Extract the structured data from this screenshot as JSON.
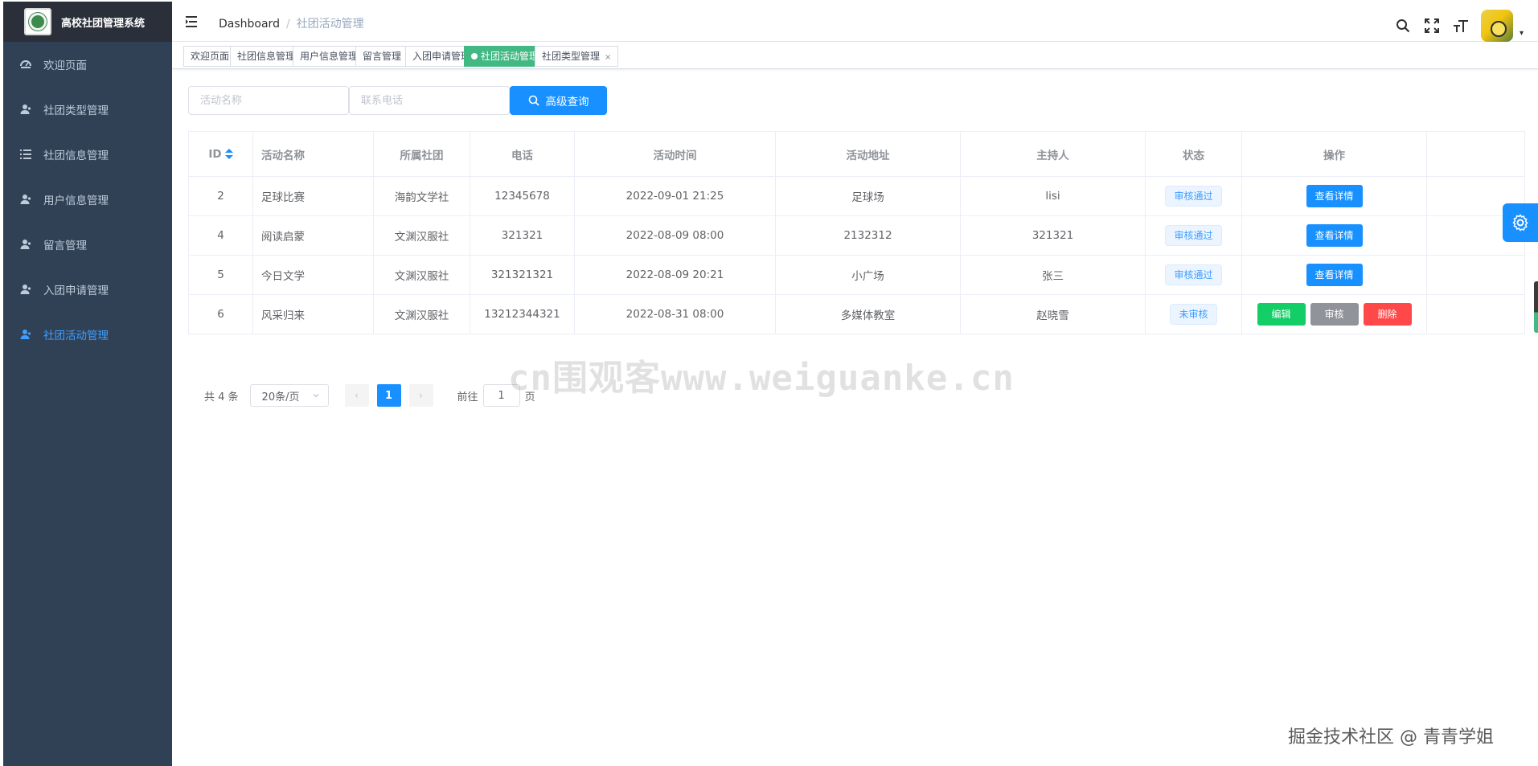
{
  "app": {
    "title": "高校社团管理系统"
  },
  "sidebar": {
    "items": [
      {
        "label": "欢迎页面",
        "icon": "dashboard-icon",
        "active": false
      },
      {
        "label": "社团类型管理",
        "icon": "user-icon",
        "active": false
      },
      {
        "label": "社团信息管理",
        "icon": "list-icon",
        "active": false
      },
      {
        "label": "用户信息管理",
        "icon": "user-icon",
        "active": false
      },
      {
        "label": "留言管理",
        "icon": "user-icon",
        "active": false
      },
      {
        "label": "入团申请管理",
        "icon": "user-icon",
        "active": false
      },
      {
        "label": "社团活动管理",
        "icon": "user-icon",
        "active": true
      }
    ]
  },
  "navbar": {
    "breadcrumb_home": "Dashboard",
    "breadcrumb_sep": "/",
    "breadcrumb_current": "社团活动管理",
    "caret": "▾"
  },
  "tags": [
    {
      "label": "欢迎页面",
      "active": false,
      "closable": false
    },
    {
      "label": "社团信息管理",
      "active": false,
      "closable": false
    },
    {
      "label": "用户信息管理",
      "active": false,
      "closable": false
    },
    {
      "label": "留言管理",
      "active": false,
      "closable": false
    },
    {
      "label": "入团申请管理",
      "active": false,
      "closable": false
    },
    {
      "label": "社团活动管理",
      "active": true,
      "closable": false
    },
    {
      "label": "社团类型管理",
      "active": false,
      "closable": true,
      "close": "×"
    }
  ],
  "search": {
    "activity_name_placeholder": "活动名称",
    "phone_placeholder": "联系电话",
    "button_label": "高级查询"
  },
  "table": {
    "headers": {
      "id": "ID",
      "name": "活动名称",
      "club": "所属社团",
      "phone": "电话",
      "time": "活动时间",
      "location": "活动地址",
      "host": "主持人",
      "status": "状态",
      "actions": "操作"
    },
    "rows": [
      {
        "id": "2",
        "name": "足球比赛",
        "club": "海韵文学社",
        "phone": "12345678",
        "time": "2022-09-01 21:25",
        "location": "足球场",
        "host": "lisi",
        "status": "审核通过",
        "approved": true
      },
      {
        "id": "4",
        "name": "阅读启蒙",
        "club": "文渊汉服社",
        "phone": "321321",
        "time": "2022-08-09 08:00",
        "location": "2132312",
        "host": "321321",
        "status": "审核通过",
        "approved": true
      },
      {
        "id": "5",
        "name": "今日文学",
        "club": "文渊汉服社",
        "phone": "321321321",
        "time": "2022-08-09 20:21",
        "location": "小广场",
        "host": "张三",
        "status": "审核通过",
        "approved": true
      },
      {
        "id": "6",
        "name": "风采归来",
        "club": "文渊汉服社",
        "phone": "13212344321",
        "time": "2022-08-31 08:00",
        "location": "多媒体教室",
        "host": "赵晓雪",
        "status": "未审核",
        "approved": false
      }
    ],
    "detail_label": "查看详情",
    "edit_label": "编辑",
    "audit_label": "审核",
    "delete_label": "删除"
  },
  "pagination": {
    "total_text": "共 4 条",
    "page_size": "20条/页",
    "current_page": "1",
    "prev": "‹",
    "next": "›",
    "goto_prefix": "前往",
    "goto_value": "1",
    "goto_suffix": "页"
  },
  "watermark": "cn围观客www.weiguanke.cn",
  "credit": "掘金技术社区 @ 青青学姐",
  "colors": {
    "sidebar_bg": "#304156",
    "primary": "#1890ff",
    "tag_active": "#42b983",
    "success": "#13ce66",
    "danger": "#ff4949",
    "info": "#909399"
  }
}
